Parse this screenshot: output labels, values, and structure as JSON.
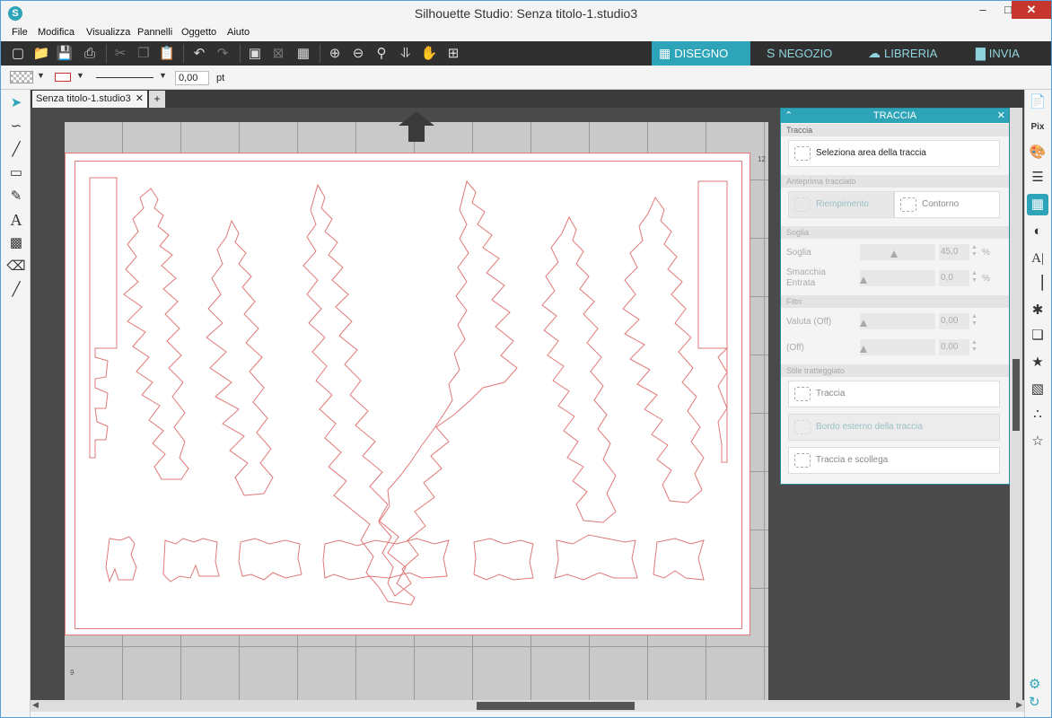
{
  "window": {
    "title": "Silhouette Studio: Senza titolo-1.studio3",
    "controls": {
      "minimize": "–",
      "maximize": "□",
      "close": "✕"
    }
  },
  "menu": [
    "File",
    "Modifica",
    "Visualizza",
    "Pannelli",
    "Oggetto",
    "Aiuto"
  ],
  "toolbar": {
    "tabs": [
      {
        "label": "DISEGNO",
        "icon": "grid-icon",
        "glyph": "▦"
      },
      {
        "label": "NEGOZIO",
        "icon": "store-icon",
        "glyph": "S"
      },
      {
        "label": "LIBRERIA",
        "icon": "cloud-icon",
        "glyph": "☁"
      },
      {
        "label": "INVIA",
        "icon": "cutter-icon",
        "glyph": "▇"
      }
    ]
  },
  "options": {
    "line_width": "0,00",
    "unit": "pt"
  },
  "document": {
    "tab_label": "Senza titolo-1.studio3",
    "close_glyph": "✕",
    "add_glyph": "+"
  },
  "canvas": {
    "ruler_top_right": "12",
    "ruler_bottom_left": "9"
  },
  "trace_panel": {
    "title": "TRACCIA",
    "section_trace": "Traccia",
    "select_area": "Seleziona area della traccia",
    "section_preview": "Anteprima tracciato",
    "fill": "Riempimento",
    "outline": "Contorno",
    "section_threshold": "Soglia",
    "threshold_label": "Soglia",
    "threshold_value": "45,0",
    "threshold_unit": "%",
    "blur_label": "Smacchia Entrata",
    "blur_value": "0,0",
    "blur_unit": "%",
    "section_filters": "Filtri",
    "filter1_label": "Valuta (Off)",
    "filter1_value": "0,00",
    "filter2_label": "(Off)",
    "filter2_value": "0,00",
    "section_style": "Stile tratteggiato",
    "style_trace": "Traccia",
    "style_outer": "Bordo esterno della traccia",
    "style_detach": "Traccia e scollega"
  },
  "colors": {
    "accent": "#2ea4b8",
    "cut_line": "#e07878",
    "toolbar_bg": "#303030"
  }
}
